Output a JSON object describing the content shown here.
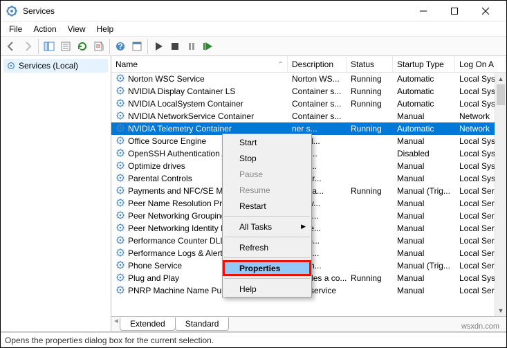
{
  "window": {
    "title": "Services"
  },
  "menu": {
    "file": "File",
    "action": "Action",
    "view": "View",
    "help": "Help"
  },
  "left": {
    "label": "Services (Local)"
  },
  "columns": {
    "name": "Name",
    "desc": "Description",
    "status": "Status",
    "stype": "Startup Type",
    "logon": "Log On A"
  },
  "tabs": {
    "extended": "Extended",
    "standard": "Standard"
  },
  "statusbar": "Opens the properties dialog box for the current selection.",
  "watermark": "wsxdn.com",
  "ctx": {
    "start": "Start",
    "stop": "Stop",
    "pause": "Pause",
    "resume": "Resume",
    "restart": "Restart",
    "alltasks": "All Tasks",
    "refresh": "Refresh",
    "properties": "Properties",
    "help": "Help"
  },
  "rows": [
    {
      "name": "Norton WSC Service",
      "desc": "Norton WS...",
      "status": "Running",
      "stype": "Automatic",
      "logon": "Local Sys"
    },
    {
      "name": "NVIDIA Display Container LS",
      "desc": "Container s...",
      "status": "Running",
      "stype": "Automatic",
      "logon": "Local Sys"
    },
    {
      "name": "NVIDIA LocalSystem Container",
      "desc": "Container s...",
      "status": "Running",
      "stype": "Automatic",
      "logon": "Local Sys"
    },
    {
      "name": "NVIDIA NetworkService Container",
      "desc": "Container s...",
      "status": "",
      "stype": "Manual",
      "logon": "Network"
    },
    {
      "name": "NVIDIA Telemetry Container",
      "desc": "ner s...",
      "status": "Running",
      "stype": "Automatic",
      "logon": "Network",
      "selected": true
    },
    {
      "name": "Office  Source Engine",
      "desc": "install...",
      "status": "",
      "stype": "Manual",
      "logon": "Local Sys"
    },
    {
      "name": "OpenSSH Authentication Age",
      "desc": "to ho...",
      "status": "",
      "stype": "Disabled",
      "logon": "Local Sys"
    },
    {
      "name": "Optimize drives",
      "desc": "the c...",
      "status": "",
      "stype": "Manual",
      "logon": "Local Sys"
    },
    {
      "name": "Parental Controls",
      "desc": "es par...",
      "status": "",
      "stype": "Manual",
      "logon": "Local Sys"
    },
    {
      "name": "Payments and NFC/SE Manag",
      "desc": "ges pa...",
      "status": "Running",
      "stype": "Manual (Trig...",
      "logon": "Local Ser"
    },
    {
      "name": "Peer Name Resolution Protoco",
      "desc": "s serv...",
      "status": "",
      "stype": "Manual",
      "logon": "Local Ser"
    },
    {
      "name": "Peer Networking Grouping",
      "desc": "s mul...",
      "status": "",
      "stype": "Manual",
      "logon": "Local Ser"
    },
    {
      "name": "Peer Networking Identity Man",
      "desc": "es ide...",
      "status": "",
      "stype": "Manual",
      "logon": "Local Ser"
    },
    {
      "name": "Performance Counter DLL Hos",
      "desc": "s rem...",
      "status": "",
      "stype": "Manual",
      "logon": "Local Ser"
    },
    {
      "name": "Performance Logs & Alerts",
      "desc": "manc...",
      "status": "",
      "stype": "Manual",
      "logon": "Local Ser"
    },
    {
      "name": "Phone Service",
      "desc": "ges th...",
      "status": "",
      "stype": "Manual (Trig...",
      "logon": "Local Ser"
    },
    {
      "name": "Plug and Play",
      "desc": "Enables a co...",
      "status": "Running",
      "stype": "Manual",
      "logon": "Local Sys"
    },
    {
      "name": "PNRP Machine Name Publication Service",
      "desc": "This service",
      "status": "",
      "stype": "Manual",
      "logon": "Local Ser"
    }
  ]
}
